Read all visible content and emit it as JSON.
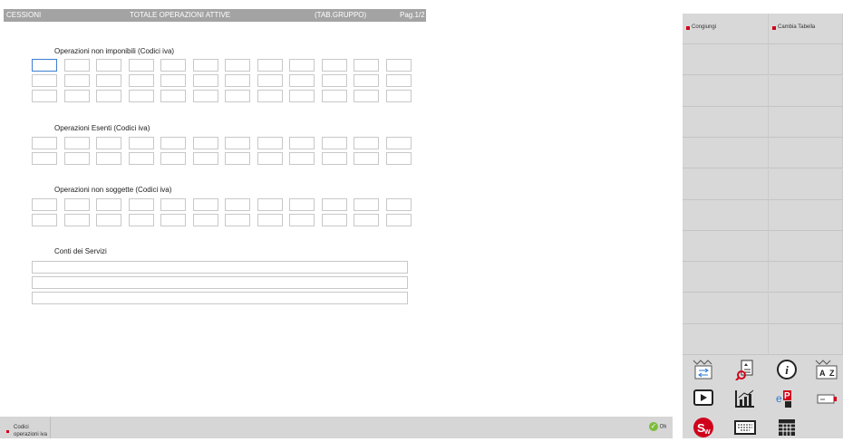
{
  "title_bar": {
    "left": "CESSIONI",
    "center": "TOTALE OPERAZIONI ATTIVE",
    "group": "(TAB.GRUPPO)",
    "page": "Pag.1/2"
  },
  "sections": [
    {
      "label": "Operazioni non imponibili (Codici iva)",
      "rows": 3,
      "cols": 12
    },
    {
      "label": "Operazioni Esenti (Codici iva)",
      "rows": 2,
      "cols": 12
    },
    {
      "label": "Operazioni non soggette (Codici iva)",
      "rows": 2,
      "cols": 12
    }
  ],
  "servizi": {
    "label": "Conti dei Servizi",
    "rows": 3
  },
  "right_panel": {
    "buttons": [
      {
        "label": "Congiungi",
        "shortcut_color": "#d0021b"
      },
      {
        "label": "Cambia Tabella",
        "shortcut_color": "#d0021b"
      }
    ],
    "icons": [
      "import-export-icon",
      "document-search-icon",
      "info-icon",
      "sort-az-icon",
      "video-play-icon",
      "chart-icon",
      "ep-lock-icon",
      "edit-field-icon",
      "sw-icon",
      "keyboard-icon",
      "calculator-icon"
    ]
  },
  "bottom": {
    "item_label_1": "Codici",
    "item_label_2": "operazioni iva",
    "ok_label": "Ok"
  },
  "colors": {
    "accent_red": "#d0021b",
    "active_border": "#3d7fd0",
    "title_bg": "#a3a3a3"
  }
}
